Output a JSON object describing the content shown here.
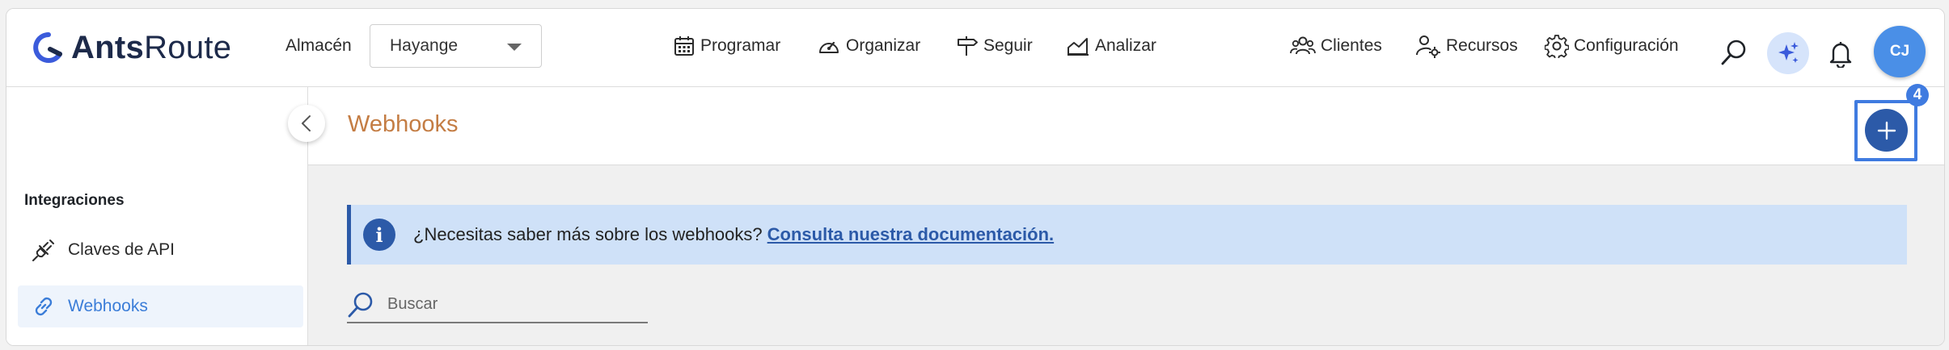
{
  "brand": {
    "name_bold": "Ants",
    "name_light": "Route"
  },
  "warehouse": {
    "label": "Almacén",
    "value": "Hayange"
  },
  "nav": {
    "programar": "Programar",
    "organizar": "Organizar",
    "seguir": "Seguir",
    "analizar": "Analizar",
    "clientes": "Clientes",
    "recursos": "Recursos",
    "configuracion": "Configuración"
  },
  "user": {
    "initials": "CJ"
  },
  "sidebar": {
    "heading": "Integraciones",
    "items": [
      {
        "label": "Claves de API",
        "icon": "plug-icon",
        "active": false
      },
      {
        "label": "Webhooks",
        "icon": "link-icon",
        "active": true
      }
    ]
  },
  "page": {
    "title": "Webhooks",
    "add_badge": "4",
    "info_text": "¿Necesitas saber más sobre los webhooks?",
    "info_link": "Consulta nuestra documentación.",
    "search_placeholder": "Buscar"
  },
  "colors": {
    "accent": "#2c5aa8",
    "title": "#c47d44",
    "highlight": "#3f7be0",
    "banner": "#cfe1f8",
    "avatar": "#4a8fe7"
  }
}
